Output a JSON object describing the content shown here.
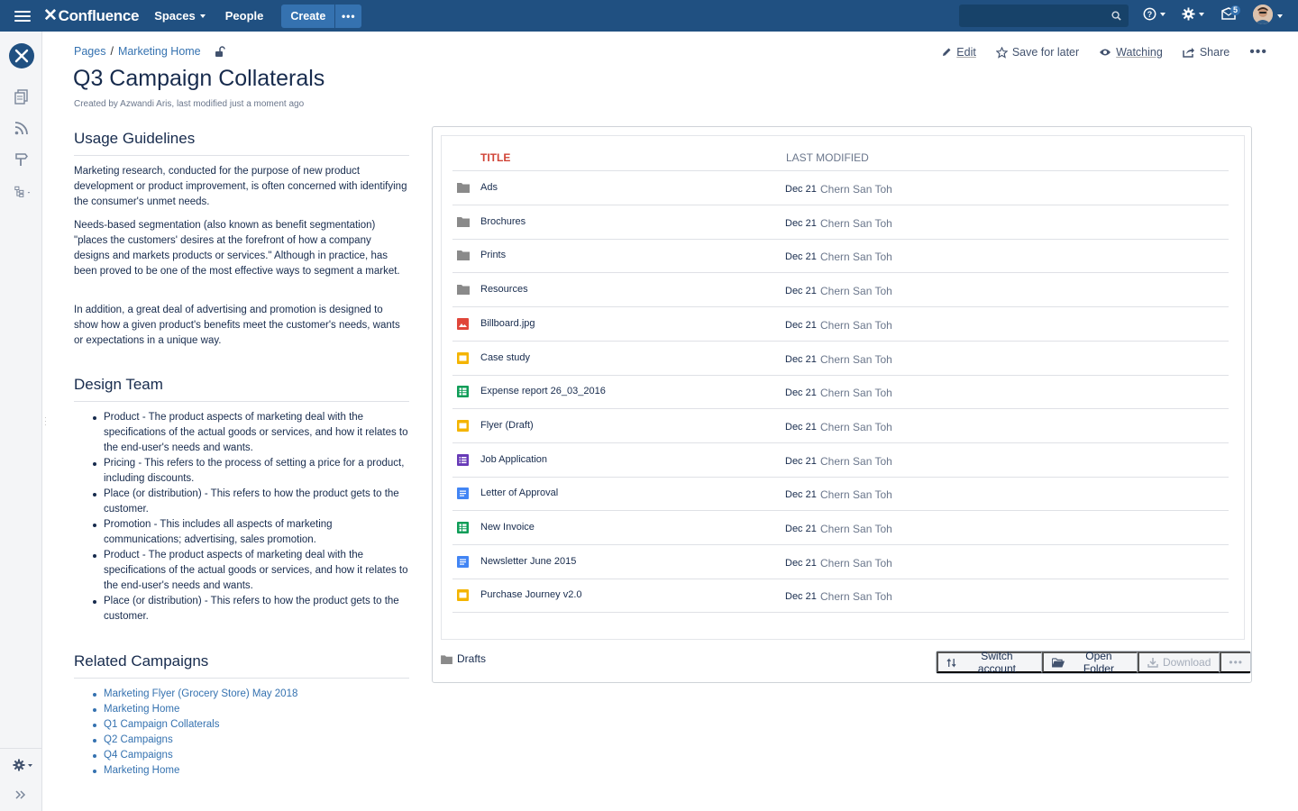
{
  "topnav": {
    "brand": "Confluence",
    "spaces_label": "Spaces",
    "people_label": "People",
    "create_label": "Create",
    "more_label": "•••",
    "search_placeholder": "",
    "notification_count": "5",
    "colors": {
      "bar": "#205081",
      "create": "#3572b0"
    }
  },
  "sidebar": {
    "icons": [
      "space-logo-icon",
      "pages-icon",
      "blog-feed-icon",
      "shortcuts-icon",
      "page-tree-icon",
      "settings-icon",
      "expand-icon"
    ]
  },
  "breadcrumb": {
    "items": [
      "Pages",
      "Marketing Home"
    ],
    "separator": "/"
  },
  "page_actions": {
    "edit": "Edit",
    "save_for_later": "Save for later",
    "watching": "Watching",
    "share": "Share",
    "more": "•••"
  },
  "page": {
    "title": "Q3 Campaign Collaterals",
    "byline": "Created by Azwandi Aris, last modified just a moment ago"
  },
  "usage": {
    "heading": "Usage Guidelines",
    "paragraphs": [
      "Marketing research, conducted for the purpose of new product development or product improvement, is often concerned with identifying the consumer's unmet needs.",
      "Needs-based segmentation (also known as benefit segmentation) \"places the customers' desires at the forefront of how a company designs and markets products or services.\" Although in practice, has been proved to be one of the most effective ways to segment a market.",
      "In addition, a great deal of advertising and promotion is designed to show how a given product's benefits meet the customer's needs, wants or expectations in a unique way."
    ]
  },
  "design_team": {
    "heading": "Design Team",
    "items": [
      "Product - The product aspects of marketing deal with the specifications of the actual goods or services, and how it relates to the end-user's needs and wants.",
      "Pricing - This refers to the process of setting a price for a product, including discounts.",
      "Place (or distribution) - This refers to how the product gets to the customer.",
      "Promotion - This includes all aspects of marketing communications; advertising, sales promotion.",
      "Product - The product aspects of marketing deal with the specifications of the actual goods or services, and how it relates to the end-user's needs and wants.",
      "Place (or distribution) - This refers to how the product gets to the customer."
    ]
  },
  "related": {
    "heading": "Related Campaigns",
    "links": [
      "Marketing Flyer (Grocery Store) May 2018",
      "Marketing Home",
      "Q1 Campaign Collaterals",
      "Q2 Campaigns",
      "Q4 Campaigns",
      "Marketing Home"
    ]
  },
  "drive": {
    "col_title": "TITLE",
    "col_modified": "LAST MODIFIED",
    "files": [
      {
        "name": "Ads",
        "type": "folder",
        "date": "Dec 21",
        "user": "Chern San Toh"
      },
      {
        "name": "Brochures",
        "type": "folder",
        "date": "Dec 21",
        "user": "Chern San Toh"
      },
      {
        "name": "Prints",
        "type": "folder",
        "date": "Dec 21",
        "user": "Chern San Toh"
      },
      {
        "name": "Resources",
        "type": "folder",
        "date": "Dec 21",
        "user": "Chern San Toh"
      },
      {
        "name": "Billboard.jpg",
        "type": "image",
        "date": "Dec 21",
        "user": "Chern San Toh"
      },
      {
        "name": "Case study",
        "type": "slides",
        "date": "Dec 21",
        "user": "Chern San Toh"
      },
      {
        "name": "Expense report 26_03_2016",
        "type": "sheet",
        "date": "Dec 21",
        "user": "Chern San Toh"
      },
      {
        "name": "Flyer (Draft)",
        "type": "slides",
        "date": "Dec 21",
        "user": "Chern San Toh"
      },
      {
        "name": "Job Application",
        "type": "form",
        "date": "Dec 21",
        "user": "Chern San Toh"
      },
      {
        "name": "Letter of Approval",
        "type": "doc",
        "date": "Dec 21",
        "user": "Chern San Toh"
      },
      {
        "name": "New Invoice",
        "type": "sheet",
        "date": "Dec 21",
        "user": "Chern San Toh"
      },
      {
        "name": "Newsletter June 2015",
        "type": "doc",
        "date": "Dec 21",
        "user": "Chern San Toh"
      },
      {
        "name": "Purchase Journey v2.0",
        "type": "slides",
        "date": "Dec 21",
        "user": "Chern San Toh"
      }
    ],
    "icon_colors": {
      "folder": "#8a8a8a",
      "image": "#e0463a",
      "slides": "#f4b400",
      "sheet": "#0f9d58",
      "form": "#673ab7",
      "doc": "#4285f4"
    },
    "folder_name": "Drafts",
    "buttons": {
      "switch_account": "Switch account",
      "open_folder": "Open Folder",
      "download": "Download",
      "more": "•••"
    }
  }
}
